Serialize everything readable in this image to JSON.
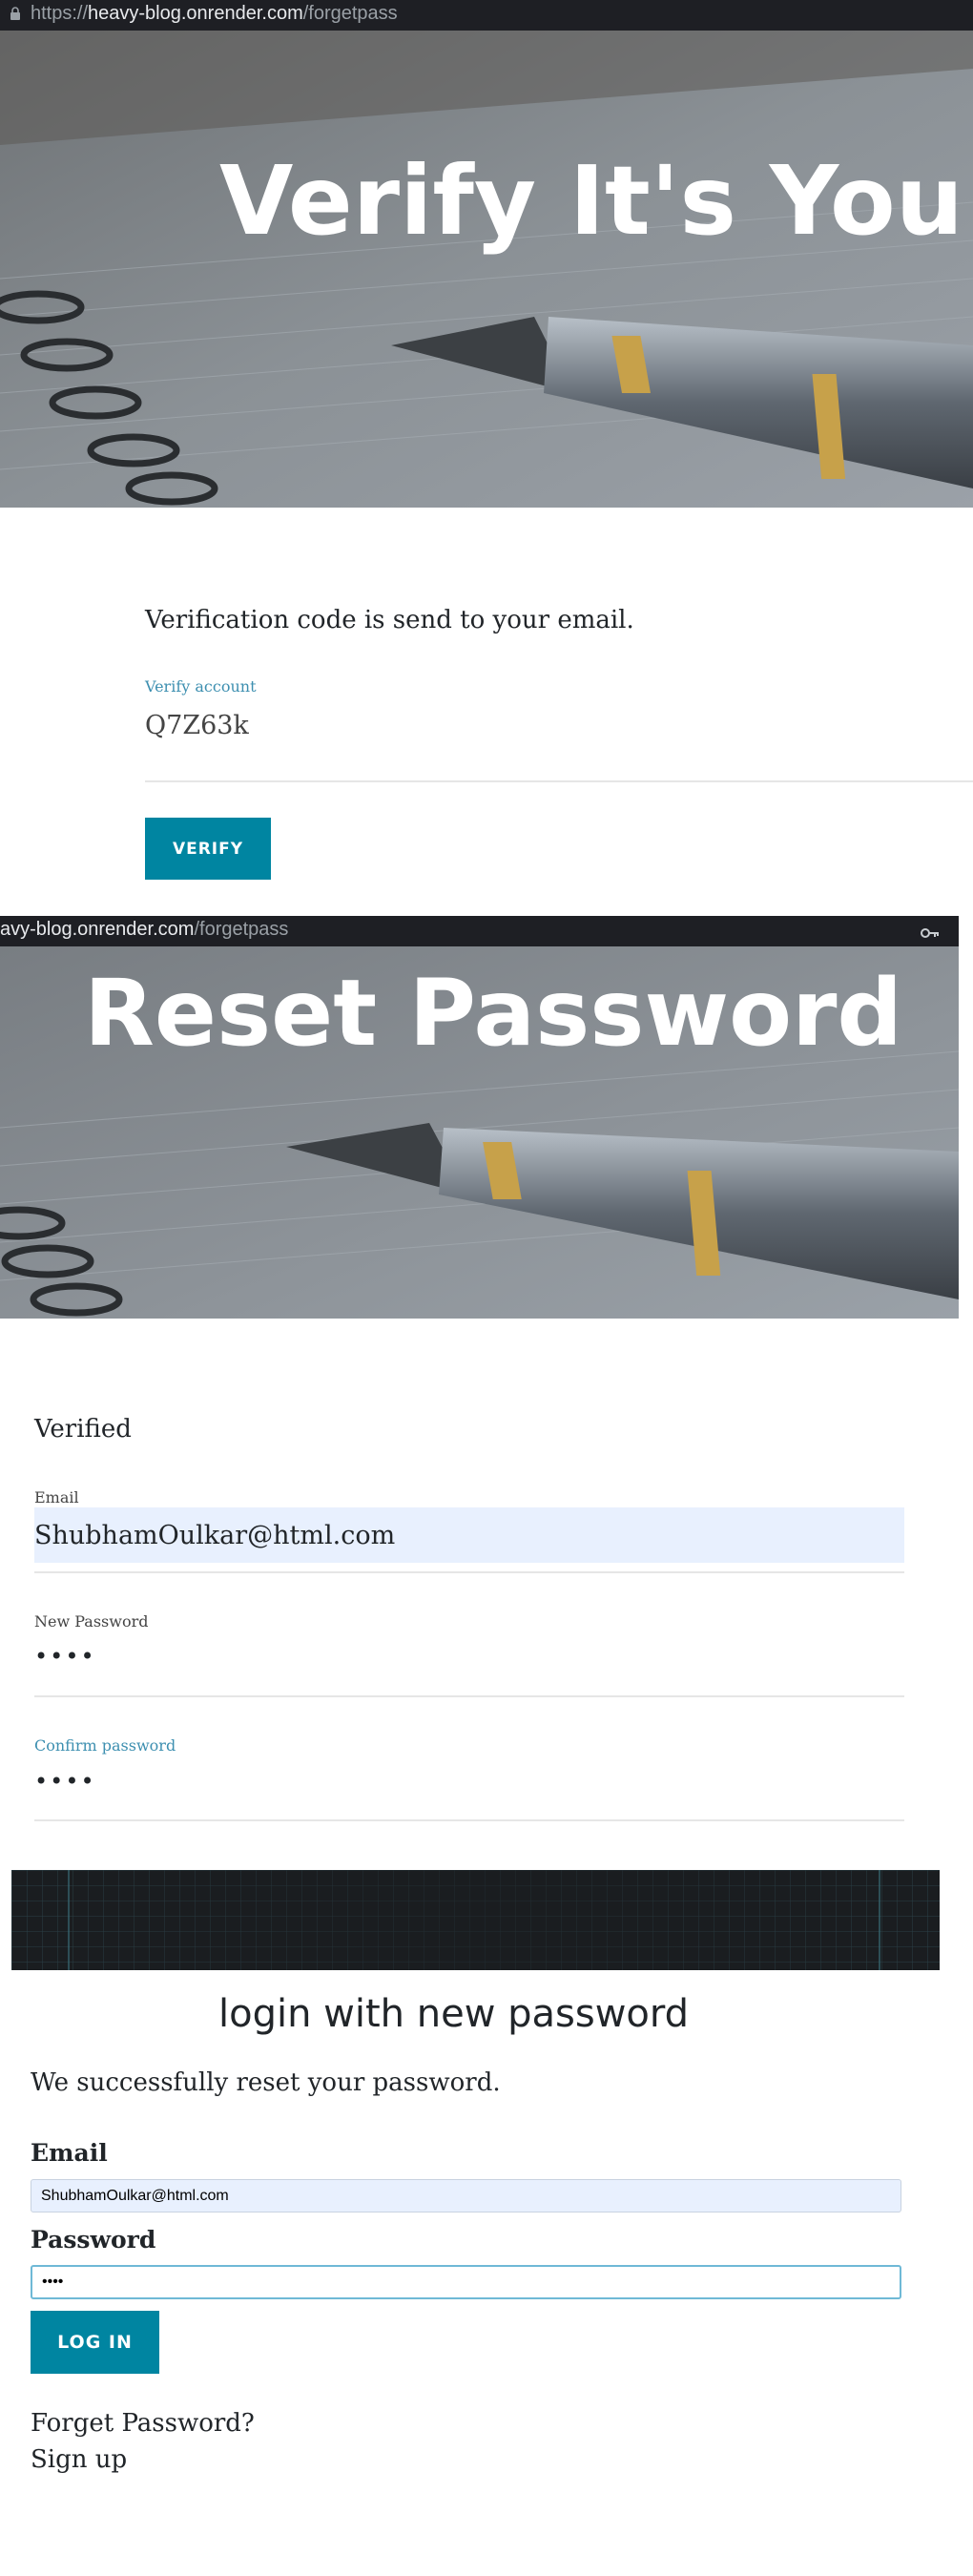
{
  "section1": {
    "url": {
      "scheme": "https://",
      "host": "heavy-blog.onrender.com",
      "path": "/forgetpass"
    },
    "hero_title": "Verify It's You!",
    "message": "Verification code is send to your email.",
    "field_label": "Verify account",
    "field_value": "Q7Z63k",
    "button_label": "VERIFY"
  },
  "section2": {
    "url": {
      "host": "avy-blog.onrender.com",
      "path": "/forgetpass"
    },
    "hero_title": "Reset Password",
    "status": "Verified",
    "email_label": "Email",
    "email_value": "ShubhamOulkar@html.com",
    "new_password_label": "New Password",
    "new_password_value": "••••",
    "confirm_password_label": "Confirm password",
    "confirm_password_value": "••••"
  },
  "section3": {
    "heading": "login with new password",
    "message": "We successfully reset your password.",
    "email_label": "Email",
    "email_value": "ShubhamOulkar@html.com",
    "password_label": "Password",
    "password_value": "••••",
    "button_label": "LOG IN",
    "forget_link": "Forget Password?",
    "signup_link": "Sign up"
  },
  "colors": {
    "accent": "#0085a1",
    "label_accent": "#3d8fb0",
    "autofill": "#e8f0fe"
  },
  "icons": [
    "lock-icon",
    "key-icon"
  ]
}
